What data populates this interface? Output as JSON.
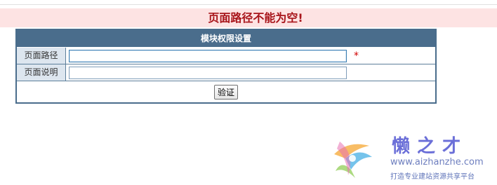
{
  "error": {
    "message": "页面路径不能为空!"
  },
  "panel": {
    "title": "模块权限设置",
    "rows": [
      {
        "label": "页面路径",
        "value": "",
        "required_mark": "*"
      },
      {
        "label": "页面说明",
        "value": ""
      }
    ],
    "submit_label": "验证"
  },
  "watermark": {
    "title": "懒之才",
    "url": "www.aizhanzhe.com",
    "slogan": "打造专业建站资源共享平台"
  },
  "colors": {
    "panel_header": "#4a6d8c",
    "label_bg": "#dde6ef",
    "error_bg": "#fde3e3",
    "error_text": "#a8141a",
    "required_star": "#d00000"
  }
}
